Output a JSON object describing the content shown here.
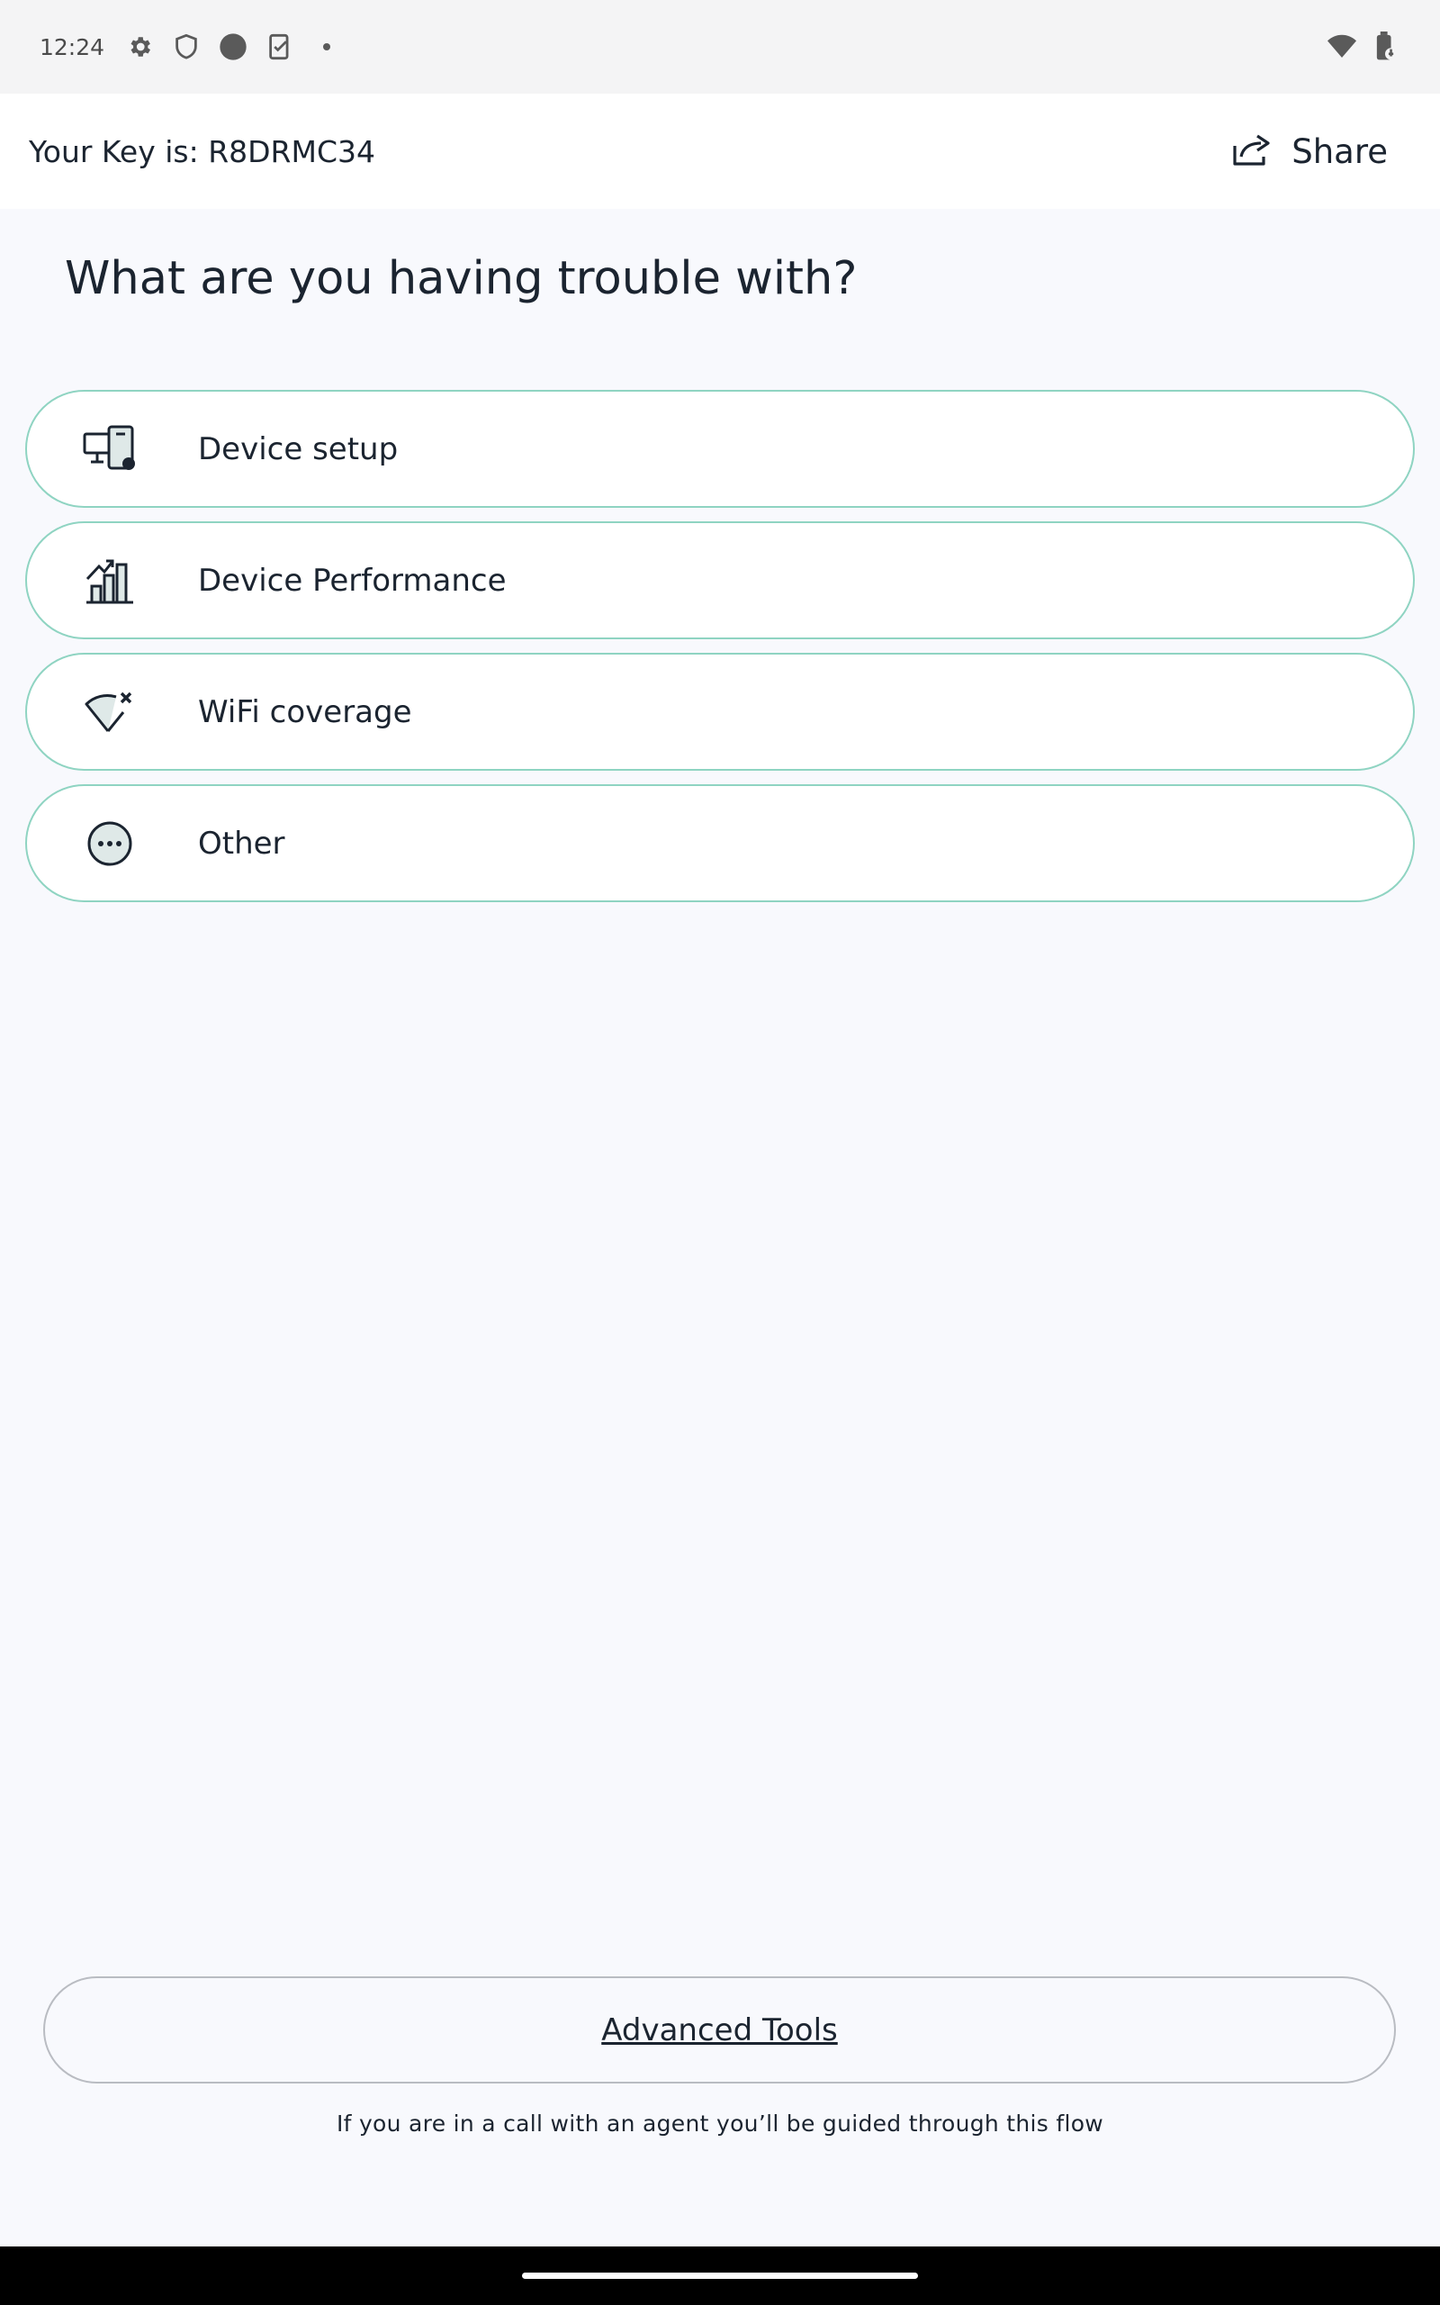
{
  "status_bar": {
    "time": "12:24",
    "icons_left": [
      "gear-icon",
      "shield-icon",
      "circle-icon",
      "task-icon",
      "dot-icon"
    ],
    "icons_right": [
      "wifi-icon",
      "battery-icon"
    ]
  },
  "header": {
    "key_text": "Your Key is: R8DRMC34",
    "share_label": "Share",
    "share_icon": "share-icon"
  },
  "page": {
    "title": "What are you having trouble with?"
  },
  "options": [
    {
      "label": "Device setup",
      "icon": "devices-icon"
    },
    {
      "label": "Device Performance",
      "icon": "performance-chart-icon"
    },
    {
      "label": "WiFi coverage",
      "icon": "wifi-off-icon"
    },
    {
      "label": "Other",
      "icon": "more-circle-icon"
    }
  ],
  "advanced_tools": {
    "label": "Advanced Tools"
  },
  "footnote": "If you are in a call with an agent you’ll be guided through this flow",
  "colors": {
    "accent_border": "#8fd4c2",
    "text": "#1b2430",
    "background": "#f8f9fd"
  }
}
